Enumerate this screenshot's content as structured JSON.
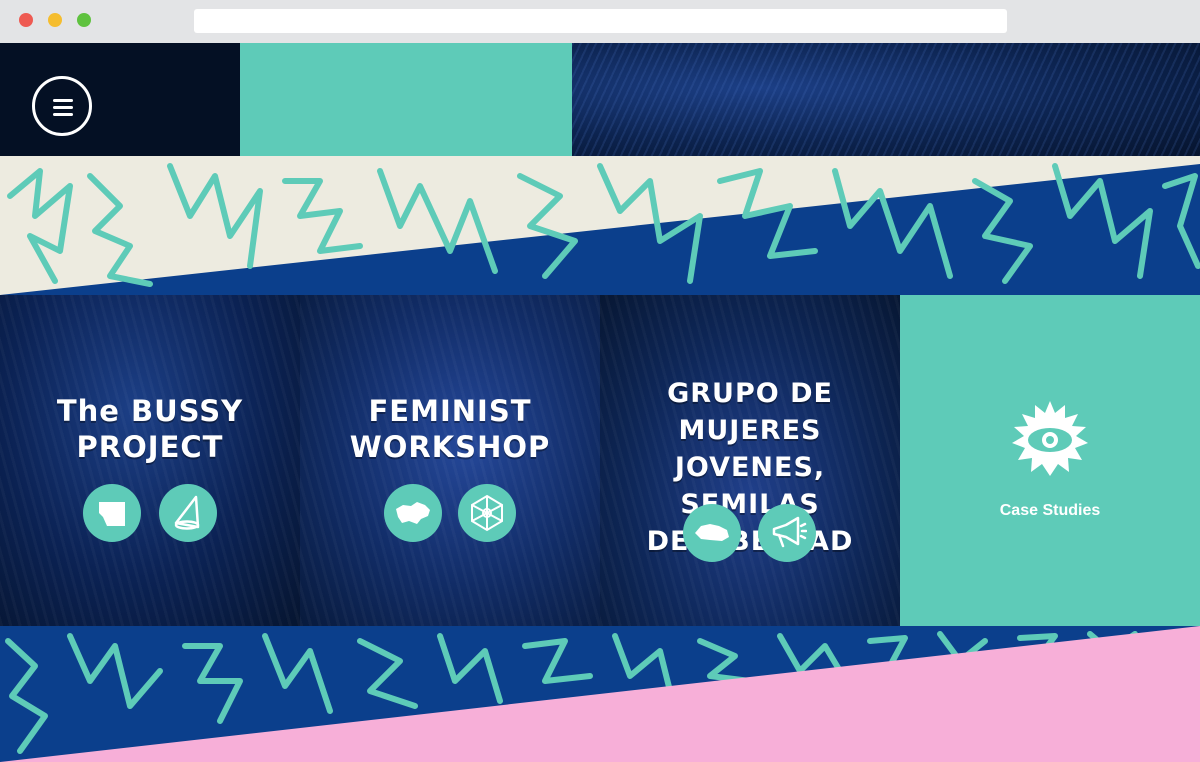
{
  "window": {
    "url": ""
  },
  "header": {
    "menu_icon": "hamburger-menu-icon"
  },
  "projects": [
    {
      "title_line1": "The BUSSY",
      "title_line2": "PROJECT",
      "icons": [
        "egypt-map-icon",
        "cone-icon"
      ]
    },
    {
      "title_line1": "FEMINIST",
      "title_line2": "WORKSHOP",
      "icons": [
        "ukraine-map-icon",
        "network-icon"
      ]
    },
    {
      "title_line1": "GRUPO DE MUJERES",
      "title_line2": "JOVENES, SEMILAS",
      "title_line3": "DE LIBERTAD",
      "icons": [
        "el-salvador-map-icon",
        "megaphone-icon"
      ]
    }
  ],
  "case_studies": {
    "label": "Case Studies",
    "icon": "eye-icon"
  },
  "colors": {
    "mint": "#5ecbb8",
    "navy": "#0b3f8c",
    "cream": "#edebe0",
    "pink": "#f7afd8",
    "dark": "#041024"
  }
}
